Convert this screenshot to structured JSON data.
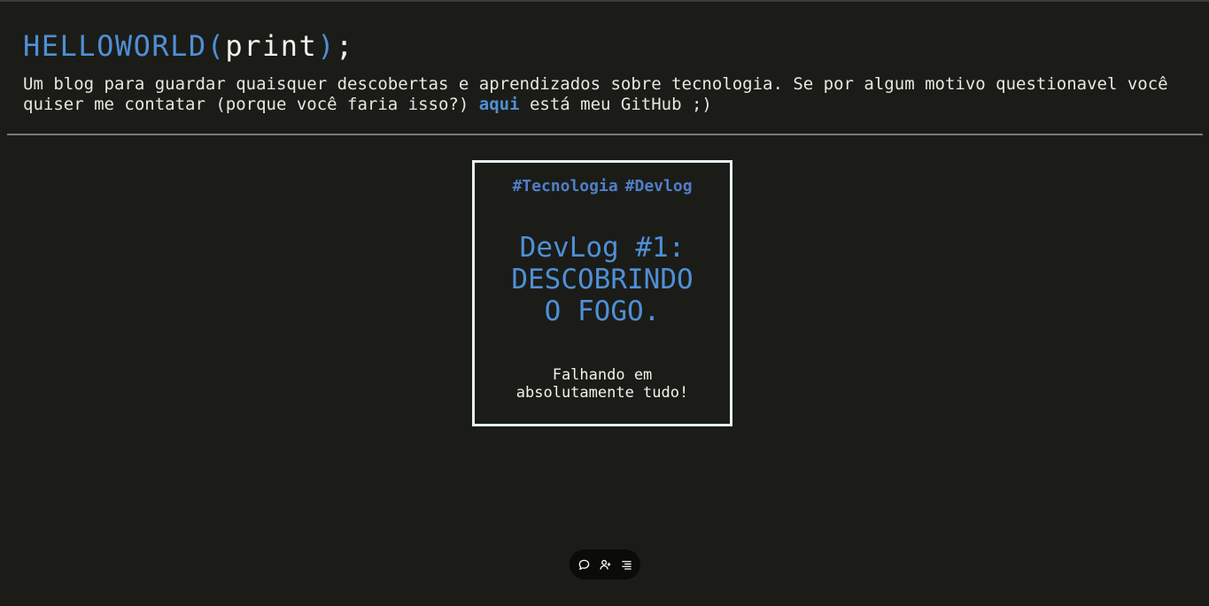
{
  "header": {
    "title_fn": "HELLOWORLD",
    "title_open": "(",
    "title_arg": "print",
    "title_close": ")",
    "title_semi": ";",
    "tagline_before": "Um blog para guardar quaisquer descobertas e aprendizados sobre tecnologia. Se por algum motivo questionavel você quiser me contatar (porque você faria isso?) ",
    "tagline_link": "aqui",
    "tagline_after": " está meu GitHub ;)"
  },
  "posts": [
    {
      "tags": [
        "#Tecnologia",
        "#Devlog"
      ],
      "title_lines": [
        "DevLog #1:",
        "DESCOBRINDO",
        "O FOGO."
      ],
      "description": "Falhando em absolutamente tudo!"
    }
  ],
  "toolbar": {
    "icons": [
      "comment-icon",
      "add-user-icon",
      "menu-list-icon"
    ]
  },
  "colors": {
    "background": "#1b1c18",
    "accent": "#4f8fd6",
    "text": "#e8e8e0",
    "card_border": "#e6f1f7"
  }
}
